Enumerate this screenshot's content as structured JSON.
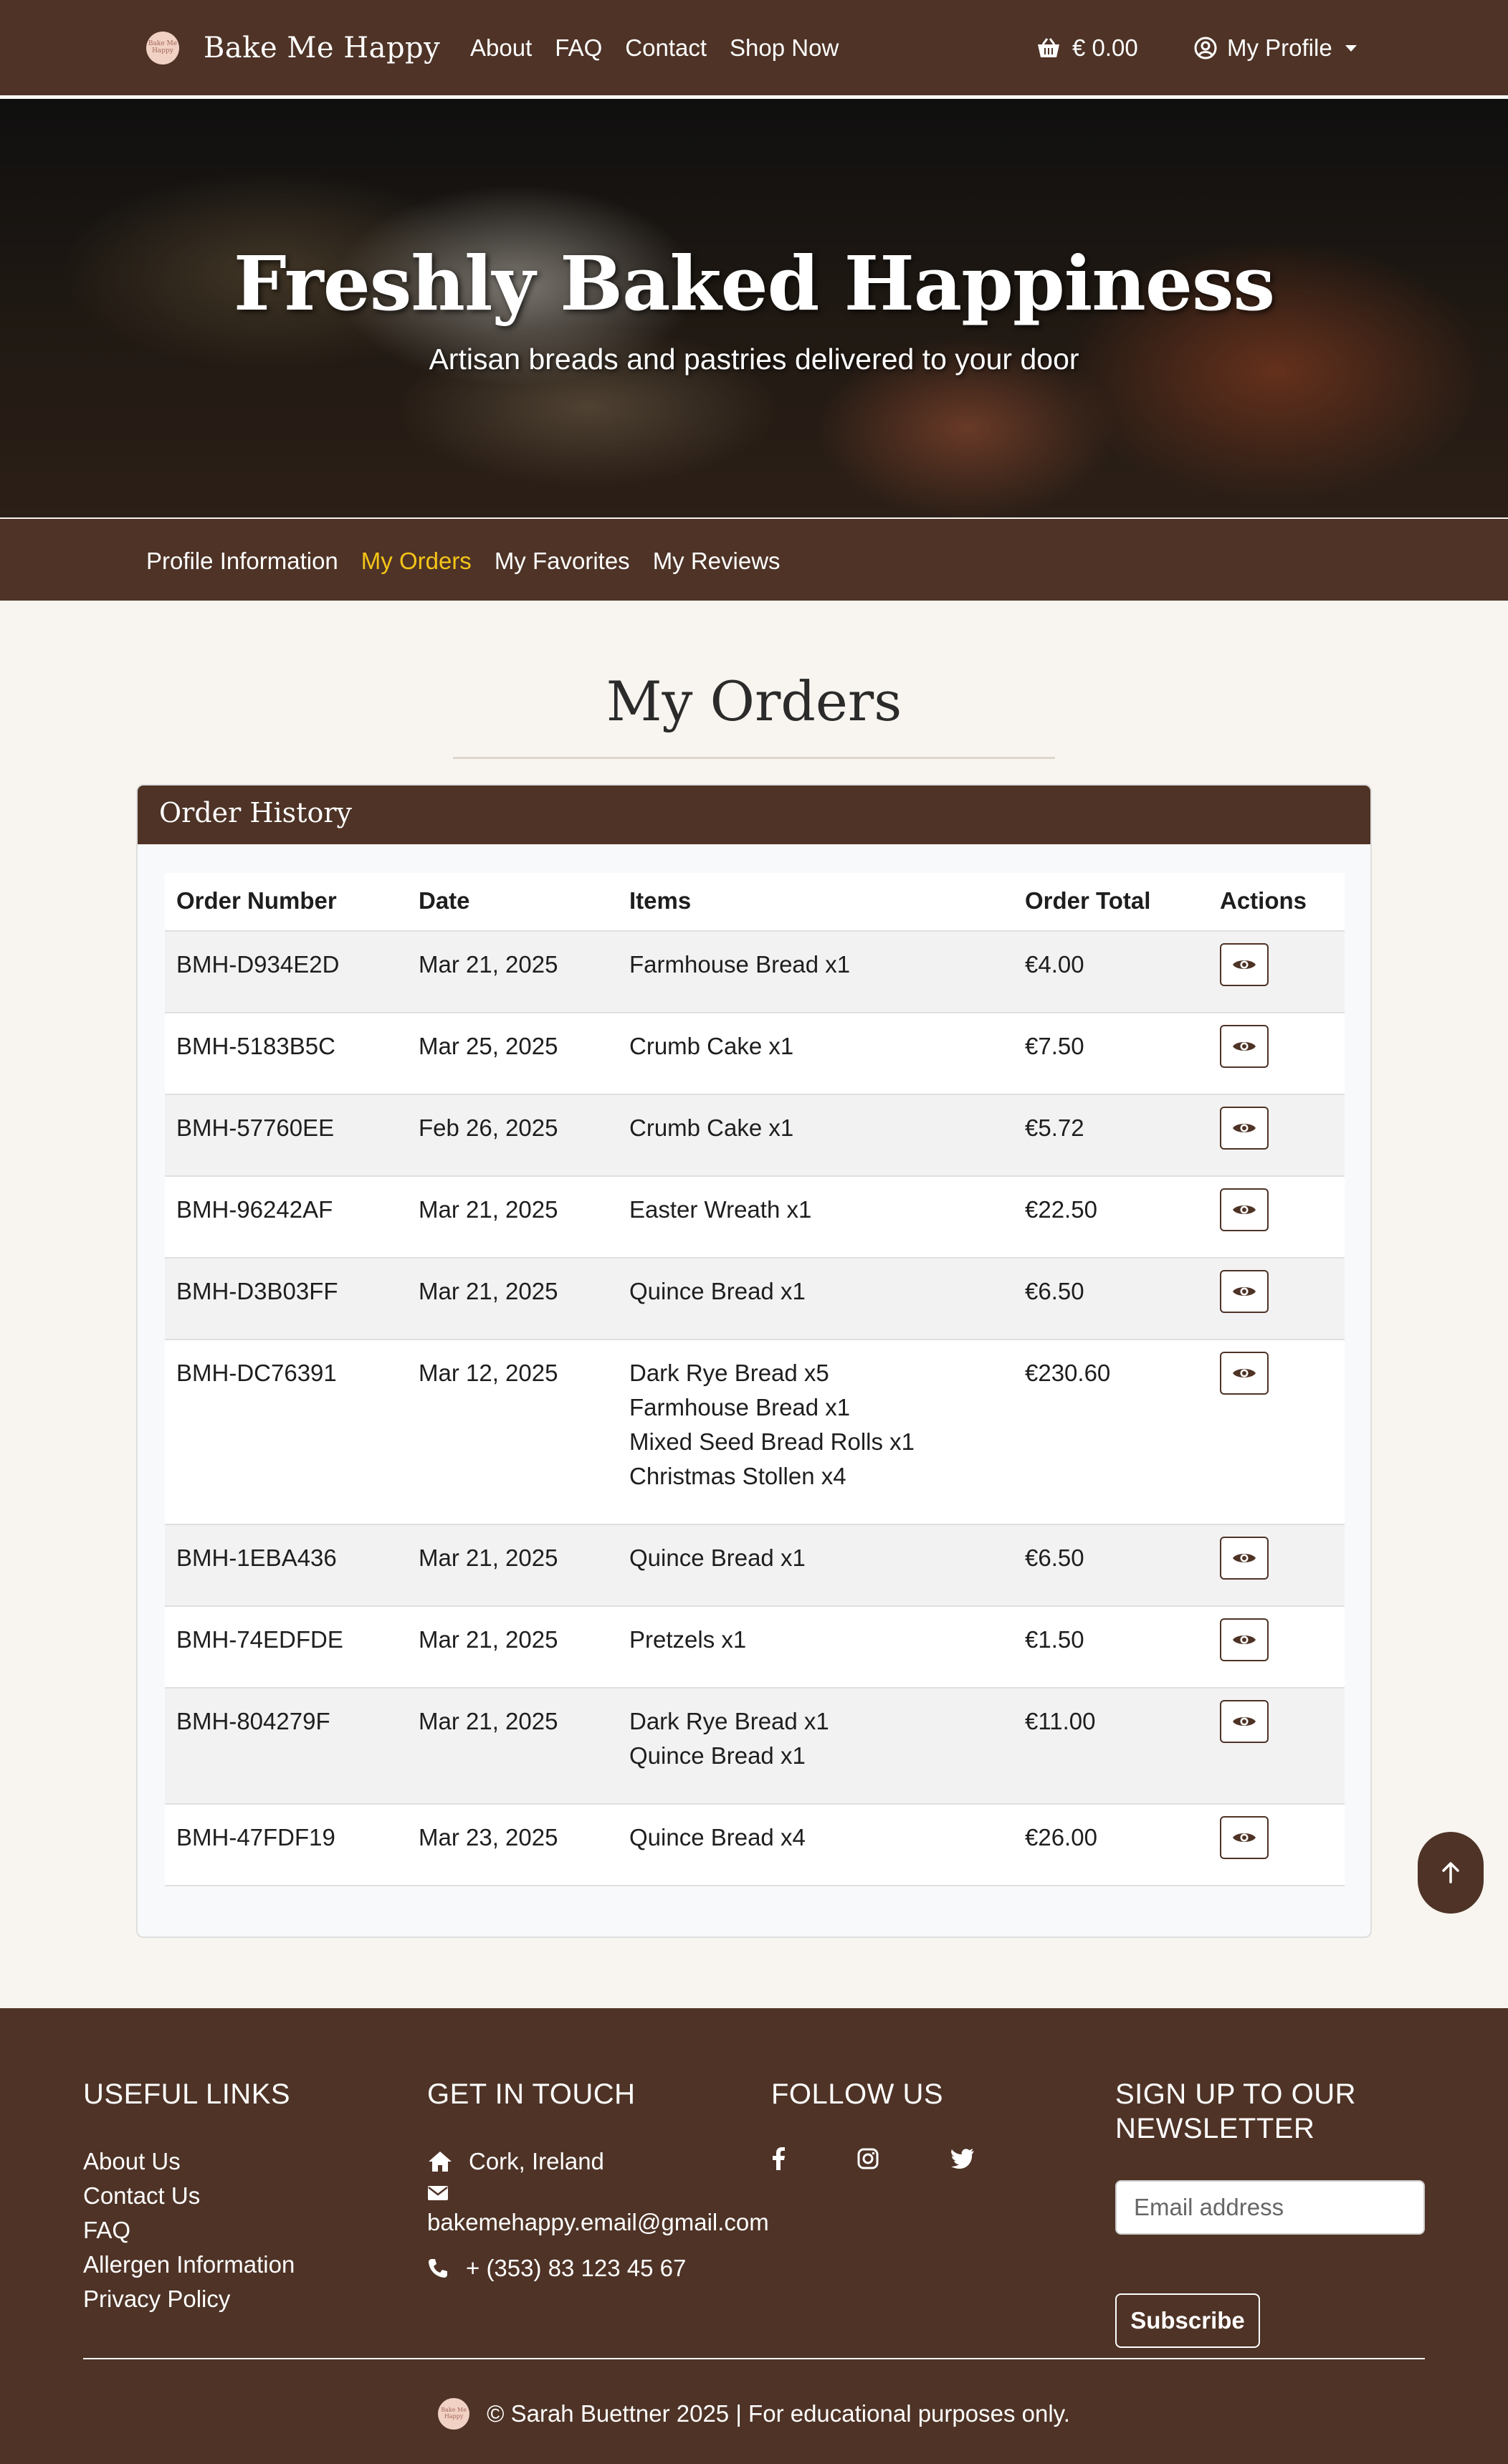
{
  "brand": {
    "name": "Bake Me Happy",
    "logo_text": "Bake Me Happy"
  },
  "nav": {
    "links": [
      "About",
      "FAQ",
      "Contact",
      "Shop Now"
    ],
    "cart_total": "€ 0.00",
    "profile_label": "My Profile"
  },
  "hero": {
    "title": "Freshly Baked Happiness",
    "subtitle": "Artisan breads and pastries delivered to your door"
  },
  "subnav": {
    "links": [
      "Profile Information",
      "My Orders",
      "My Favorites",
      "My Reviews"
    ],
    "active": "My Orders"
  },
  "page_title": "My Orders",
  "order_history": {
    "header": "Order History",
    "columns": [
      "Order Number",
      "Date",
      "Items",
      "Order Total",
      "Actions"
    ],
    "rows": [
      {
        "number": "BMH-D934E2D",
        "date": "Mar 21, 2025",
        "items": [
          "Farmhouse Bread x1"
        ],
        "total": "€4.00"
      },
      {
        "number": "BMH-5183B5C",
        "date": "Mar 25, 2025",
        "items": [
          "Crumb Cake x1"
        ],
        "total": "€7.50"
      },
      {
        "number": "BMH-57760EE",
        "date": "Feb 26, 2025",
        "items": [
          "Crumb Cake x1"
        ],
        "total": "€5.72"
      },
      {
        "number": "BMH-96242AF",
        "date": "Mar 21, 2025",
        "items": [
          "Easter Wreath x1"
        ],
        "total": "€22.50"
      },
      {
        "number": "BMH-D3B03FF",
        "date": "Mar 21, 2025",
        "items": [
          "Quince Bread x1"
        ],
        "total": "€6.50"
      },
      {
        "number": "BMH-DC76391",
        "date": "Mar 12, 2025",
        "items": [
          "Dark Rye Bread x5",
          "Farmhouse Bread x1",
          "Mixed Seed Bread Rolls x1",
          "Christmas Stollen x4"
        ],
        "total": "€230.60"
      },
      {
        "number": "BMH-1EBA436",
        "date": "Mar 21, 2025",
        "items": [
          "Quince Bread x1"
        ],
        "total": "€6.50"
      },
      {
        "number": "BMH-74EDFDE",
        "date": "Mar 21, 2025",
        "items": [
          "Pretzels x1"
        ],
        "total": "€1.50"
      },
      {
        "number": "BMH-804279F",
        "date": "Mar 21, 2025",
        "items": [
          "Dark Rye Bread x1",
          "Quince Bread x1"
        ],
        "total": "€11.00"
      },
      {
        "number": "BMH-47FDF19",
        "date": "Mar 23, 2025",
        "items": [
          "Quince Bread x4"
        ],
        "total": "€26.00"
      }
    ],
    "action_icon": "eye-icon"
  },
  "footer": {
    "useful_links": {
      "heading": "USEFUL LINKS",
      "links": [
        "About Us",
        "Contact Us",
        "FAQ",
        "Allergen Information",
        "Privacy Policy"
      ]
    },
    "get_in_touch": {
      "heading": "GET IN TOUCH",
      "location": "Cork, Ireland",
      "email": "bakemehappy.email@gmail.com",
      "phone": "+ (353) 83 123 45 67"
    },
    "follow_us": {
      "heading": "FOLLOW US",
      "icons": [
        "facebook-icon",
        "instagram-icon",
        "twitter-icon"
      ]
    },
    "newsletter": {
      "heading": "SIGN UP TO OUR NEWSLETTER",
      "placeholder": "Email address",
      "button": "Subscribe"
    },
    "copyright": "© Sarah Buettner 2025 | For educational purposes only."
  },
  "colors": {
    "brand_brown": "#4e3326",
    "active_link": "#f5c518",
    "page_bg": "#f8f4ef"
  }
}
